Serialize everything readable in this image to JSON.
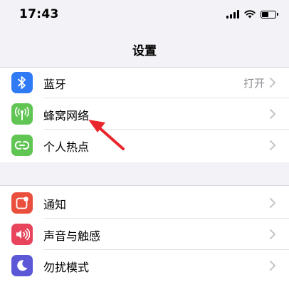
{
  "status_bar": {
    "time": "17:43",
    "battery_level": 0.45
  },
  "nav": {
    "title": "设置"
  },
  "groups": [
    {
      "items": [
        {
          "label": "蓝牙",
          "value": "打开",
          "icon": "bluetooth-icon",
          "color": "#2f7bf6"
        },
        {
          "label": "蜂窝网络",
          "value": "",
          "icon": "cellular-antenna-icon",
          "color": "#61c554"
        },
        {
          "label": "个人热点",
          "value": "",
          "icon": "personal-hotspot-icon",
          "color": "#61c554"
        }
      ]
    },
    {
      "items": [
        {
          "label": "通知",
          "value": "",
          "icon": "notifications-icon",
          "color": "#ea4f3d"
        },
        {
          "label": "声音与触感",
          "value": "",
          "icon": "sounds-icon",
          "color": "#e8455c"
        },
        {
          "label": "勿扰模式",
          "value": "",
          "icon": "moon-icon",
          "color": "#5b57d6"
        }
      ]
    }
  ],
  "annotation": {
    "color": "#e8262b"
  }
}
